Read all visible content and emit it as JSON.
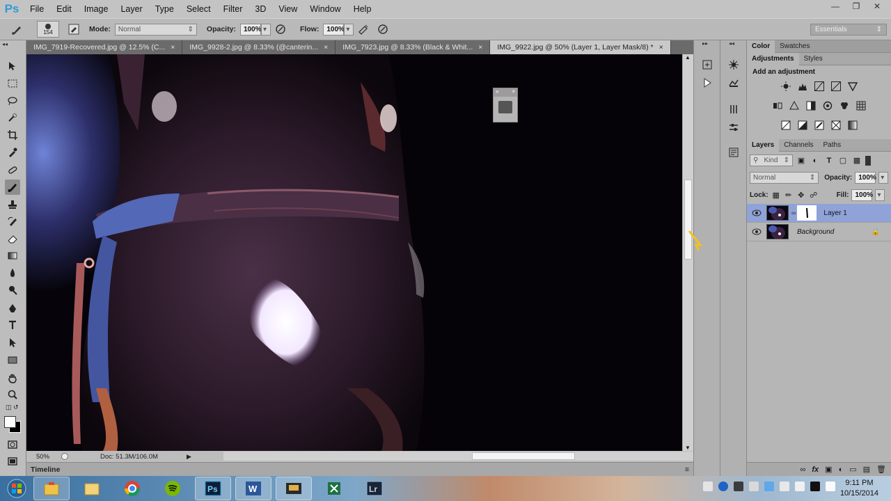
{
  "app": {
    "logo": "Ps"
  },
  "menu": [
    "File",
    "Edit",
    "Image",
    "Layer",
    "Type",
    "Select",
    "Filter",
    "3D",
    "View",
    "Window",
    "Help"
  ],
  "options": {
    "brush_size": "154",
    "mode_label": "Mode:",
    "mode_value": "Normal",
    "opacity_label": "Opacity:",
    "opacity_value": "100%",
    "flow_label": "Flow:",
    "flow_value": "100%",
    "workspace": "Essentials"
  },
  "tabs": [
    {
      "label": "IMG_7919-Recovered.jpg @ 12.5% (C...",
      "close": "×"
    },
    {
      "label": "IMG_9928-2.jpg @ 8.33% (@canterin...",
      "close": "×"
    },
    {
      "label": "IMG_7923.jpg @ 8.33% (Black & Whit...",
      "close": "×"
    },
    {
      "label": "IMG_9922.jpg @ 50% (Layer 1, Layer Mask/8) *",
      "close": "×"
    }
  ],
  "status": {
    "zoom": "50%",
    "doc": "Doc: 51.3M/106.0M"
  },
  "timeline": {
    "label": "Timeline"
  },
  "panels": {
    "color_tabs": [
      "Color",
      "Swatches"
    ],
    "adjust_tabs": [
      "Adjustments",
      "Styles"
    ],
    "adjust_title": "Add an adjustment",
    "layer_tabs": [
      "Layers",
      "Channels",
      "Paths"
    ],
    "kind": "Kind",
    "blend": "Normal",
    "opacity_label": "Opacity:",
    "opacity_value": "100%",
    "lock_label": "Lock:",
    "fill_label": "Fill:",
    "fill_value": "100%",
    "layers": [
      {
        "name": "Layer 1",
        "selected": true
      },
      {
        "name": "Background",
        "selected": false
      }
    ]
  },
  "taskbar": {
    "apps": [
      "start",
      "explorer-folder",
      "libraries",
      "chrome",
      "spotify",
      "photoshop",
      "word",
      "cast",
      "excel",
      "lightroom"
    ],
    "time": "9:11 PM",
    "date": "10/15/2014"
  },
  "colors": {
    "accent": "#8fa3d8",
    "ps_blue": "#2f9bd6"
  }
}
